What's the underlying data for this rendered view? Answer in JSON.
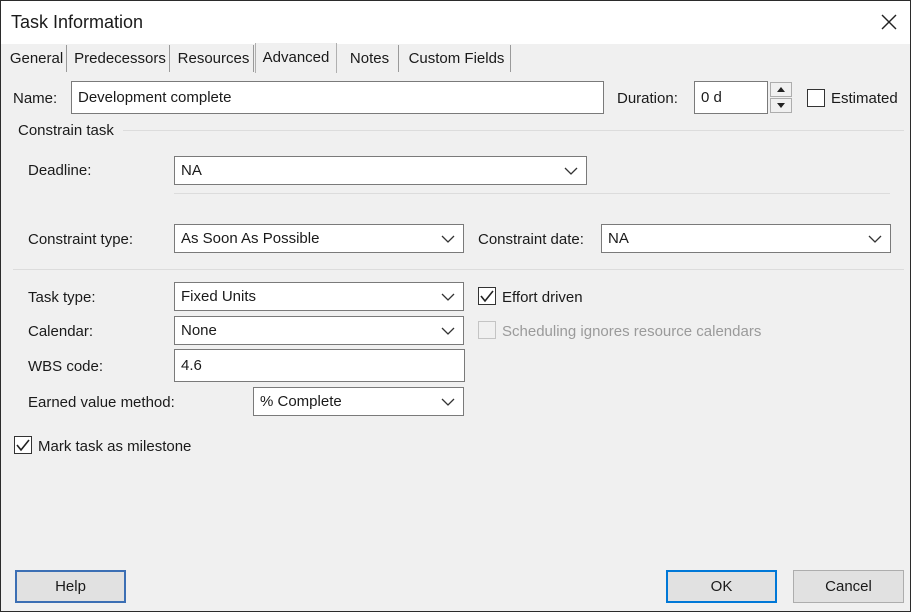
{
  "window": {
    "title": "Task Information"
  },
  "tabs": [
    {
      "label": "General"
    },
    {
      "label": "Predecessors"
    },
    {
      "label": "Resources"
    },
    {
      "label": "Advanced"
    },
    {
      "label": "Notes"
    },
    {
      "label": "Custom Fields"
    }
  ],
  "form": {
    "name_label": "Name:",
    "name_value": "Development complete",
    "duration_label": "Duration:",
    "duration_value": "0 d",
    "estimated_label": "Estimated",
    "constrain_task_label": "Constrain task",
    "deadline_label": "Deadline:",
    "deadline_value": "NA",
    "constraint_type_label": "Constraint type:",
    "constraint_type_value": "As Soon As Possible",
    "constraint_date_label": "Constraint date:",
    "constraint_date_value": "NA",
    "task_type_label": "Task type:",
    "task_type_value": "Fixed Units",
    "effort_driven_label": "Effort driven",
    "calendar_label": "Calendar:",
    "calendar_value": "None",
    "scheduling_ignores_label": "Scheduling ignores resource calendars",
    "wbs_label": "WBS code:",
    "wbs_value": "4.6",
    "earned_value_label": "Earned value method:",
    "earned_value_value": "% Complete",
    "milestone_label": "Mark task as milestone"
  },
  "checkboxes": {
    "estimated": false,
    "effort_driven": true,
    "scheduling_ignores": false,
    "milestone": true
  },
  "buttons": {
    "help": "Help",
    "ok": "OK",
    "cancel": "Cancel"
  },
  "icons": {
    "close": "close-icon",
    "dropdown": "chevron-down-icon",
    "check": "checkmark-icon",
    "spin_up": "spin-up-icon",
    "spin_down": "spin-down-icon"
  },
  "colors": {
    "dialog_bg": "#f0f0f0",
    "title_bg": "#ffffff",
    "default_button_border": "#0078d7",
    "disabled_text": "#9a9a9a"
  }
}
